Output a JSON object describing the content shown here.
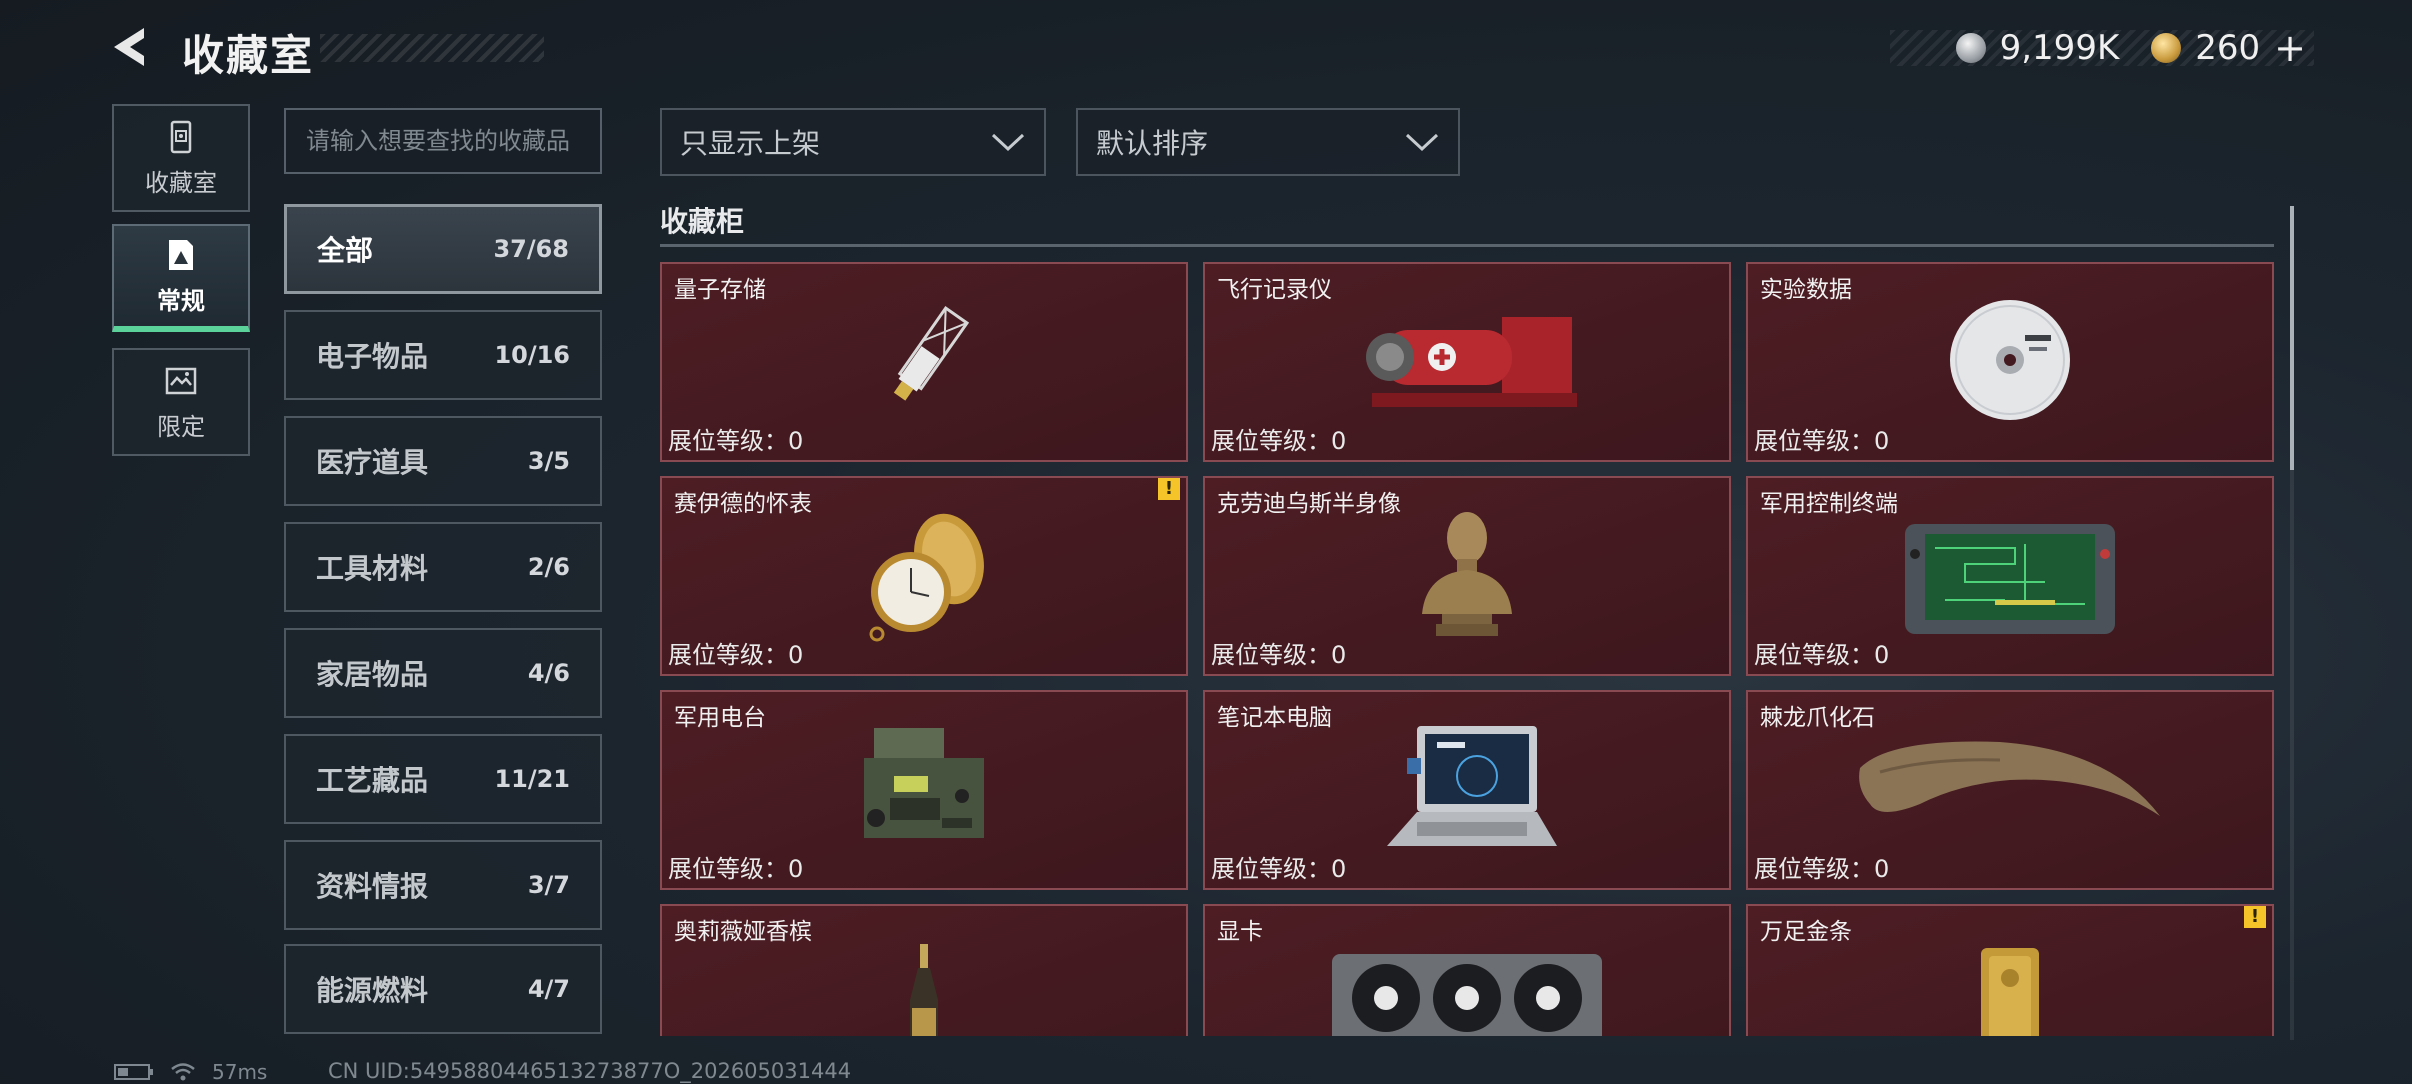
{
  "header": {
    "title": "收藏室",
    "currencies": [
      {
        "icon": "silver-coin-icon",
        "value": "9,199K"
      },
      {
        "icon": "gold-coin-icon",
        "value": "260"
      }
    ],
    "add_label": "+"
  },
  "nav": {
    "items": [
      {
        "label": "收藏室",
        "icon": "collection-room-icon"
      },
      {
        "label": "常规",
        "icon": "regular-icon",
        "active": true
      },
      {
        "label": "限定",
        "icon": "limited-icon"
      }
    ]
  },
  "search": {
    "placeholder": "请输入想要查找的收藏品"
  },
  "categories": [
    {
      "name": "全部",
      "count": "37/68",
      "active": true
    },
    {
      "name": "电子物品",
      "count": "10/16"
    },
    {
      "name": "医疗道具",
      "count": "3/5"
    },
    {
      "name": "工具材料",
      "count": "2/6"
    },
    {
      "name": "家居物品",
      "count": "4/6"
    },
    {
      "name": "工艺藏品",
      "count": "11/21"
    },
    {
      "name": "资料情报",
      "count": "3/7"
    },
    {
      "name": "能源燃料",
      "count": "4/7"
    }
  ],
  "filters": {
    "display_filter": "只显示上架",
    "sort": "默认排序"
  },
  "section": {
    "title": "收藏柜"
  },
  "items": [
    {
      "name": "量子存储",
      "level": "展位等级：0"
    },
    {
      "name": "飞行记录仪",
      "level": "展位等级：0"
    },
    {
      "name": "实验数据",
      "level": "展位等级：0"
    },
    {
      "name": "赛伊德的怀表",
      "level": "展位等级：0",
      "warning": "!"
    },
    {
      "name": "克劳迪乌斯半身像",
      "level": "展位等级：0"
    },
    {
      "name": "军用控制终端",
      "level": "展位等级：0"
    },
    {
      "name": "军用电台",
      "level": "展位等级：0"
    },
    {
      "name": "笔记本电脑",
      "level": "展位等级：0"
    },
    {
      "name": "棘龙爪化石",
      "level": "展位等级：0"
    },
    {
      "name": "奥莉薇娅香槟",
      "level": ""
    },
    {
      "name": "显卡",
      "level": ""
    },
    {
      "name": "万足金条",
      "level": "",
      "warning": "!"
    }
  ],
  "status": {
    "ping": "57ms",
    "uid": "CN UID:5495880446513273877O_202605031444"
  }
}
